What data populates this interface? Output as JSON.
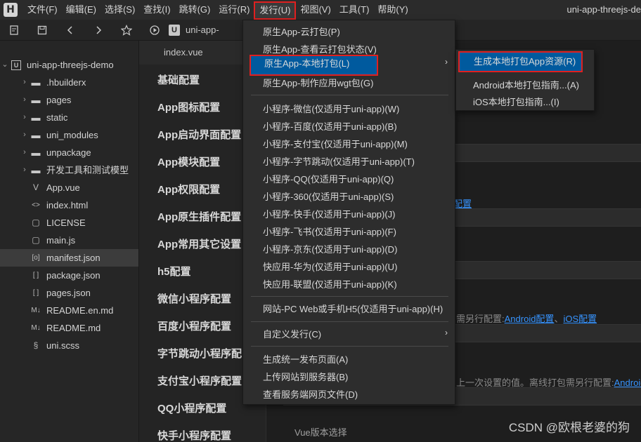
{
  "menubar": {
    "logo": "H",
    "items": [
      "文件(F)",
      "编辑(E)",
      "选择(S)",
      "查找(I)",
      "跳转(G)",
      "运行(R)",
      "发行(U)",
      "视图(V)",
      "工具(T)",
      "帮助(Y)"
    ],
    "window_title": "uni-app-threejs-de"
  },
  "toolbar": {
    "project_icon": "U",
    "path": "uni-app-"
  },
  "sidebar": {
    "project": "uni-app-threejs-demo",
    "items": [
      {
        "label": ".hbuilderx",
        "icon": "folder-icon",
        "arrow": "›"
      },
      {
        "label": "pages",
        "icon": "folder-icon",
        "arrow": "›"
      },
      {
        "label": "static",
        "icon": "folder-icon",
        "arrow": "›"
      },
      {
        "label": "uni_modules",
        "icon": "folder-icon",
        "arrow": "›"
      },
      {
        "label": "unpackage",
        "icon": "folder-icon",
        "arrow": "›"
      },
      {
        "label": "开发工具和测试模型",
        "icon": "folder-icon",
        "arrow": "›"
      },
      {
        "label": "App.vue",
        "icon": "vue-file-icon",
        "arrow": ""
      },
      {
        "label": "index.html",
        "icon": "html-file-icon",
        "arrow": ""
      },
      {
        "label": "LICENSE",
        "icon": "text-file-icon",
        "arrow": ""
      },
      {
        "label": "main.js",
        "icon": "js-file-icon",
        "arrow": ""
      },
      {
        "label": "manifest.json",
        "icon": "settings-file-icon",
        "arrow": ""
      },
      {
        "label": "package.json",
        "icon": "json-file-icon",
        "arrow": ""
      },
      {
        "label": "pages.json",
        "icon": "json-file-icon",
        "arrow": ""
      },
      {
        "label": "README.en.md",
        "icon": "markdown-file-icon",
        "arrow": ""
      },
      {
        "label": "README.md",
        "icon": "markdown-file-icon",
        "arrow": ""
      },
      {
        "label": "uni.scss",
        "icon": "scss-file-icon",
        "arrow": ""
      }
    ]
  },
  "editor": {
    "tab_label": "index.vue",
    "nav": [
      "基础配置",
      "App图标配置",
      "App启动界面配置",
      "App模块配置",
      "App权限配置",
      "App原生插件配置",
      "App常用其它设置",
      "h5配置",
      "微信小程序配置",
      "百度小程序配置",
      "字节跳动小程序配",
      "支付宝小程序配置",
      "QQ小程序配置",
      "快手小程序配置"
    ],
    "bg_link_1": "配置",
    "bg_text_2": "需另行配置:",
    "bg_link_android": "Android配置",
    "bg_sep": "、",
    "bg_link_ios": "iOS配置",
    "bg_text_3": "上一次设置的值。离线打包需另行配置:",
    "bg_link_android2": "Android",
    "bg_text_vue": "Vue版本选择"
  },
  "dropdown": {
    "group1": [
      "原生App-云打包(P)",
      "原生App-查看云打包状态(V)",
      "原生App-本地打包(L)",
      "原生App-制作应用wgt包(G)"
    ],
    "group2": [
      "小程序-微信(仅适用于uni-app)(W)",
      "小程序-百度(仅适用于uni-app)(B)",
      "小程序-支付宝(仅适用于uni-app)(M)",
      "小程序-字节跳动(仅适用于uni-app)(T)",
      "小程序-QQ(仅适用于uni-app)(Q)",
      "小程序-360(仅适用于uni-app)(S)",
      "小程序-快手(仅适用于uni-app)(J)",
      "小程序-飞书(仅适用于uni-app)(F)",
      "小程序-京东(仅适用于uni-app)(D)",
      "快应用-华为(仅适用于uni-app)(U)",
      "快应用-联盟(仅适用于uni-app)(K)"
    ],
    "group3": [
      "网站-PC Web或手机H5(仅适用于uni-app)(H)"
    ],
    "group4": [
      "自定义发行(C)"
    ],
    "group5": [
      "生成统一发布页面(A)",
      "上传网站到服务器(B)",
      "查看服务端网页文件(D)"
    ],
    "submenu_arrow": "›"
  },
  "submenu": {
    "items": [
      "生成本地打包App资源(R)",
      "Android本地打包指南...(A)",
      "iOS本地打包指南...(I)"
    ]
  },
  "watermark": "CSDN @欧根老婆的狗",
  "colors": {
    "highlight": "#005a9e",
    "annotation_red": "#e02020",
    "link": "#3794ff"
  }
}
